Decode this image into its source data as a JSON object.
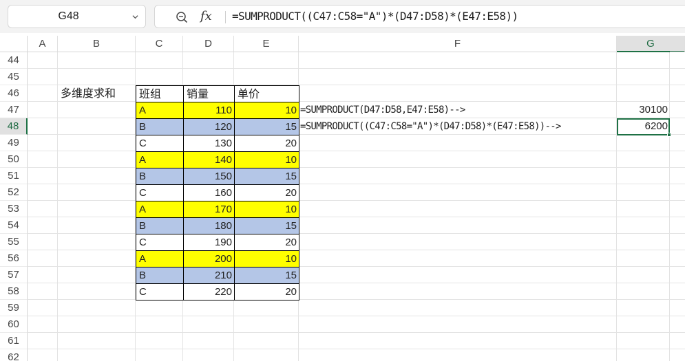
{
  "name_box": {
    "value": "G48"
  },
  "formula_bar": {
    "fx_label": "fx",
    "formula": "=SUMPRODUCT((C47:C58=\"A\")*(D47:D58)*(E47:E58))"
  },
  "columns": [
    "A",
    "B",
    "C",
    "D",
    "E",
    "F",
    "G"
  ],
  "selected_column": "G",
  "rows": [
    "44",
    "45",
    "46",
    "47",
    "48",
    "49",
    "50",
    "51",
    "52",
    "53",
    "54",
    "55",
    "56",
    "57",
    "58",
    "59",
    "60",
    "61",
    "62"
  ],
  "selected_row": "48",
  "colors": {
    "yellow": "#ffff00",
    "blue": "#b4c6e7",
    "accent": "#1e7145"
  },
  "title_cell": "多维度求和",
  "table": {
    "headers": [
      "班组",
      "销量",
      "单价"
    ],
    "rows": [
      {
        "group": "A",
        "sales": "110",
        "price": "10",
        "fill": "yellow"
      },
      {
        "group": "B",
        "sales": "120",
        "price": "15",
        "fill": "blue"
      },
      {
        "group": "C",
        "sales": "130",
        "price": "20",
        "fill": "white"
      },
      {
        "group": "A",
        "sales": "140",
        "price": "10",
        "fill": "yellow"
      },
      {
        "group": "B",
        "sales": "150",
        "price": "15",
        "fill": "blue"
      },
      {
        "group": "C",
        "sales": "160",
        "price": "20",
        "fill": "white"
      },
      {
        "group": "A",
        "sales": "170",
        "price": "10",
        "fill": "yellow"
      },
      {
        "group": "B",
        "sales": "180",
        "price": "15",
        "fill": "blue"
      },
      {
        "group": "C",
        "sales": "190",
        "price": "20",
        "fill": "white"
      },
      {
        "group": "A",
        "sales": "200",
        "price": "10",
        "fill": "yellow"
      },
      {
        "group": "B",
        "sales": "210",
        "price": "15",
        "fill": "blue"
      },
      {
        "group": "C",
        "sales": "220",
        "price": "20",
        "fill": "white"
      }
    ]
  },
  "notes": {
    "formula1_text": "=SUMPRODUCT(D47:D58,E47:E58)-->",
    "formula1_result": "30100",
    "formula2_text": "=SUMPRODUCT((C47:C58=\"A\")*(D47:D58)*(E47:E58))-->",
    "formula2_result": "6200"
  }
}
